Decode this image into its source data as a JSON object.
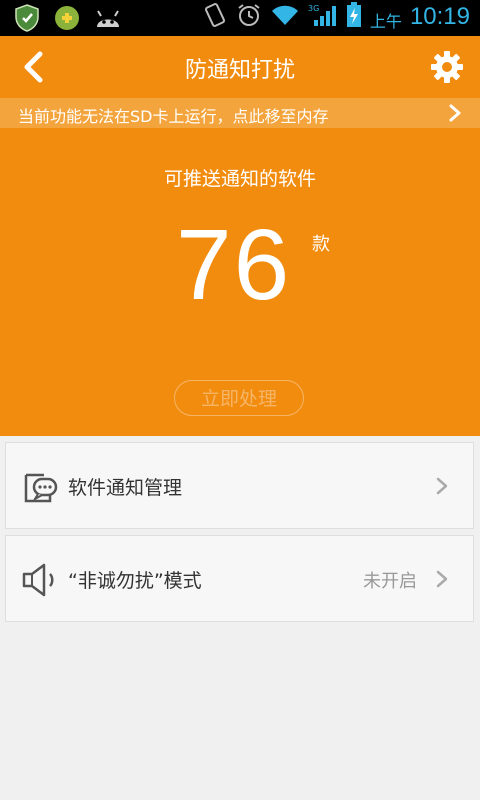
{
  "status_bar": {
    "ampm": "上午",
    "time": "10:19",
    "icons": [
      "shield-icon",
      "game-icon",
      "android-icon",
      "vibrate-icon",
      "alarm-icon",
      "wifi-icon",
      "signal-3g-icon",
      "battery-charging-icon"
    ]
  },
  "header": {
    "title": "防通知打扰",
    "back_icon": "chevron-left-icon",
    "settings_icon": "gear-icon"
  },
  "notice": {
    "text": "当前功能无法在SD卡上运行，点此移至内存"
  },
  "hero": {
    "label": "可推送通知的软件",
    "count": "76",
    "unit": "款",
    "action_label": "立即处理"
  },
  "list": [
    {
      "label": "软件通知管理",
      "status": "",
      "icon": "message-icon"
    },
    {
      "label": "“非诚勿扰”模式",
      "status": "未开启",
      "icon": "speaker-icon"
    }
  ],
  "colors": {
    "accent": "#f28c0f",
    "notice_bg": "#f4a43c",
    "status_clock": "#33b5e5"
  }
}
